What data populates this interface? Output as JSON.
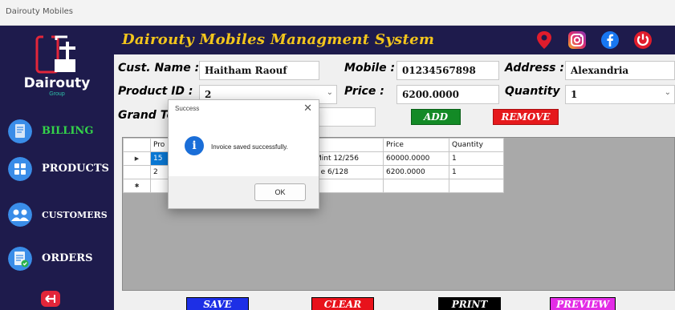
{
  "window": {
    "title": "Dairouty Mobiles"
  },
  "app": {
    "title": "Dairouty Mobiles Managment System"
  },
  "logo": {
    "name": "Dairouty",
    "subtitle": "Group"
  },
  "sidebar": {
    "items": [
      {
        "label": "BILLING",
        "icon": "bill-icon",
        "active": true
      },
      {
        "label": "PRODUCTS",
        "icon": "grid-icon"
      },
      {
        "label": "CUSTOMERS",
        "icon": "users-icon"
      },
      {
        "label": "ORDERS",
        "icon": "orders-icon"
      }
    ],
    "logout_icon": "logout-icon"
  },
  "header": {
    "icons": [
      "location-icon",
      "instagram-icon",
      "facebook-icon",
      "power-icon"
    ]
  },
  "form": {
    "customer_label": "Cust. Name :",
    "customer_value": "Haitham Raouf",
    "mobile_label": "Mobile :",
    "mobile_value": "01234567898",
    "address_label": "Address :",
    "address_value": "Alexandria",
    "product_label": "Product ID :",
    "product_value": "2",
    "price_label": "Price :",
    "price_value": "6200.0000",
    "quantity_label": "Quantity",
    "quantity_value": "1",
    "grand_total_label": "Grand To"
  },
  "buttons": {
    "add": "ADD",
    "remove": "REMOVE",
    "save": "SAVE",
    "clear": "CLEAR",
    "print": "PRINT",
    "preview": "PREVIEW"
  },
  "grid": {
    "columns": [
      "Pro",
      "",
      "Price",
      "Quantity"
    ],
    "rows": [
      {
        "marker": "▶",
        "id": "15",
        "name": "Mint 12/256",
        "price": "60000.0000",
        "quantity": "1"
      },
      {
        "marker": "",
        "id": "2",
        "name": "e 6/128",
        "price": "6200.0000",
        "quantity": "1"
      },
      {
        "marker": "✱",
        "id": "",
        "name": "",
        "price": "",
        "quantity": ""
      }
    ]
  },
  "dialog": {
    "title": "Success",
    "message": "Invoice saved successfully.",
    "ok": "OK",
    "close": "✕",
    "icon_glyph": "i"
  },
  "colors": {
    "sidebar_bg": "#1e1b4c",
    "title_gold": "#f3c61c",
    "billing_green": "#34d34a",
    "add_green": "#138a26",
    "remove_red": "#e6191c",
    "save_blue": "#1d2fe6",
    "clear_red": "#e8121b",
    "print_black": "#000000",
    "preview_magenta": "#e32ce6"
  }
}
